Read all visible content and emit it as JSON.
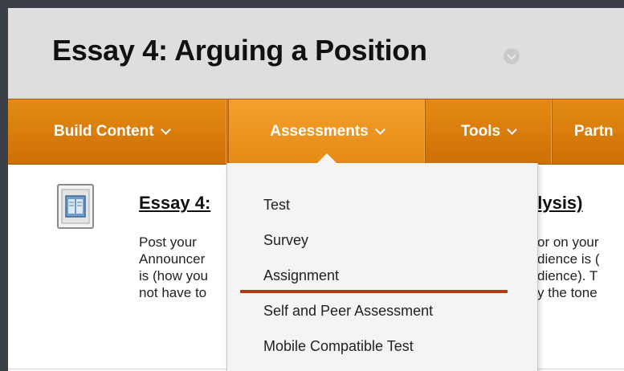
{
  "page": {
    "title": "Essay 4: Arguing a Position"
  },
  "toolbar": {
    "build_content": "Build Content",
    "assessments": "Assessments",
    "tools": "Tools",
    "partner": "Partn"
  },
  "content_item": {
    "icon": "document-folder-icon",
    "title_visible_start": "Essay 4:",
    "title_visible_end": "alysis)",
    "description_left": [
      "Post your",
      "Announcer",
      "is (how you",
      "not have to"
    ],
    "description_right": [
      "or on your",
      "dience is (",
      "dience). T",
      "y the tone"
    ]
  },
  "assessments_menu": {
    "items": [
      "Test",
      "Survey",
      "Assignment",
      "Self and Peer Assessment",
      "Mobile Compatible Test"
    ],
    "underlined_item": "Assignment"
  },
  "colors": {
    "toolbar_orange": "#d97a0b",
    "active_tab_orange": "#ef9a27",
    "highlight_underline": "#b33a12",
    "title_bar_gray": "#dedede",
    "background_dark": "#3b4048"
  }
}
